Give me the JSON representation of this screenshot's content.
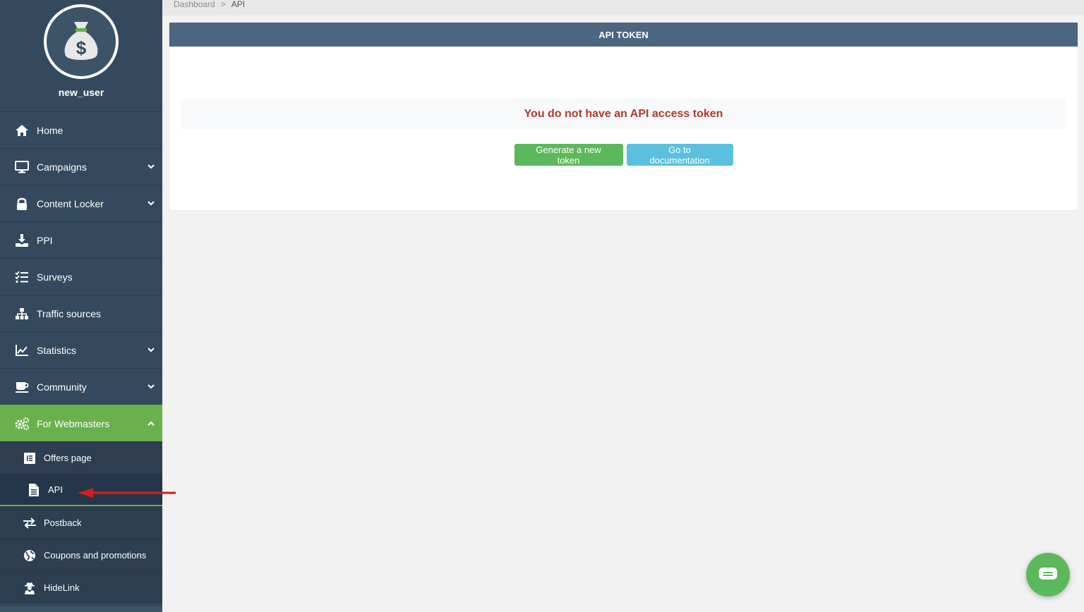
{
  "user": {
    "name": "new_user",
    "avatar_icon": "money-bag-icon"
  },
  "sidebar": {
    "items": [
      {
        "label": "Home",
        "icon": "home-icon"
      },
      {
        "label": "Campaigns",
        "icon": "monitor-icon",
        "chevron": "down"
      },
      {
        "label": "Content Locker",
        "icon": "lock-icon",
        "chevron": "down"
      },
      {
        "label": "PPI",
        "icon": "download-icon"
      },
      {
        "label": "Surveys",
        "icon": "checklist-icon"
      },
      {
        "label": "Traffic sources",
        "icon": "sitemap-icon"
      },
      {
        "label": "Statistics",
        "icon": "chart-icon",
        "chevron": "down"
      },
      {
        "label": "Community",
        "icon": "coffee-icon",
        "chevron": "down"
      },
      {
        "label": "For Webmasters",
        "icon": "gears-icon",
        "chevron": "up",
        "active": true
      }
    ],
    "submenu": [
      {
        "label": "Offers page",
        "icon": "list-icon"
      },
      {
        "label": "API",
        "icon": "file-icon",
        "current": true
      },
      {
        "label": "Postback",
        "icon": "exchange-icon"
      },
      {
        "label": "Coupons and promotions",
        "icon": "globe-icon"
      },
      {
        "label": "HideLink",
        "icon": "user-secret-icon"
      }
    ]
  },
  "breadcrumb": {
    "items": [
      "Dashboard",
      "API"
    ],
    "separator": ">"
  },
  "card": {
    "title": "API TOKEN",
    "notice": "You do not have an API access token",
    "generate_label": "Generate a new token",
    "docs_label": "Go to documentation"
  },
  "colors": {
    "sidebar": "#34495e",
    "active": "#6ab04c",
    "header": "#4c6580",
    "notice_text": "#b03a2e",
    "btn_green": "#5cb85c",
    "btn_blue": "#5bc0de",
    "arrow": "#d0201c"
  },
  "chat": {
    "icon": "chat-icon"
  }
}
